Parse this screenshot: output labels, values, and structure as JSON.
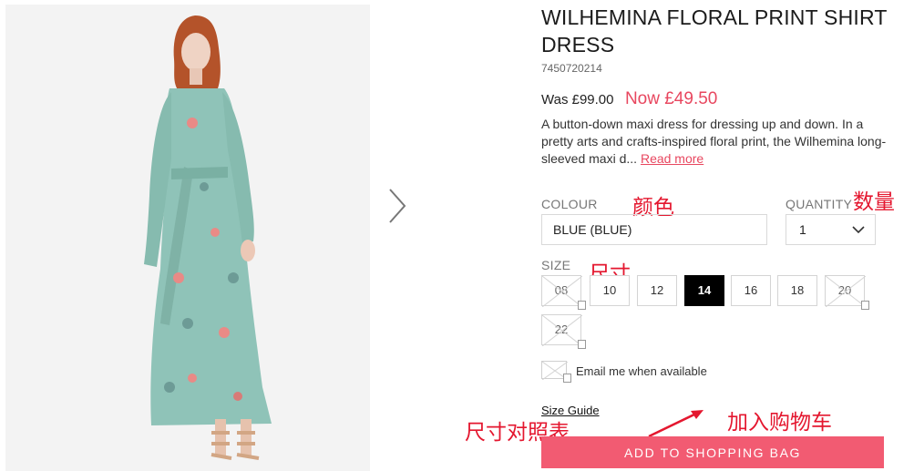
{
  "product": {
    "title": "WILHEMINA FLORAL PRINT SHIRT DRESS",
    "sku": "7450720214",
    "was_price": "Was £99.00",
    "now_price": "Now £49.50",
    "description": "A button-down maxi dress for dressing up and down. In a pretty arts and crafts-inspired floral print, the Wilhemina long-sleeved maxi d...",
    "read_more": "Read more"
  },
  "options": {
    "colour_label": "COLOUR",
    "colour_value": "BLUE (BLUE)",
    "quantity_label": "QUANTITY",
    "quantity_value": "1",
    "size_label": "SIZE",
    "sizes": [
      {
        "label": "08",
        "state": "unavailable"
      },
      {
        "label": "10",
        "state": "available"
      },
      {
        "label": "12",
        "state": "available"
      },
      {
        "label": "14",
        "state": "selected"
      },
      {
        "label": "16",
        "state": "available"
      },
      {
        "label": "18",
        "state": "available"
      },
      {
        "label": "20",
        "state": "unavailable"
      },
      {
        "label": "22",
        "state": "unavailable"
      }
    ]
  },
  "email": {
    "label": "Email me when available"
  },
  "size_guide": "Size Guide",
  "add_button": "ADD TO SHOPPING BAG",
  "annotations": {
    "colour": "颜色",
    "quantity": "数量",
    "size": "尺寸",
    "size_guide": "尺寸对照表",
    "add_to_cart": "加入购物车"
  },
  "colors": {
    "accent_pink": "#f25b72",
    "sale_red": "#e8475f",
    "annotation_red": "#e4172f",
    "selected_size": "#000000"
  },
  "icons": {
    "next": "chevron-right-icon",
    "quantity_dropdown": "chevron-down-icon"
  }
}
